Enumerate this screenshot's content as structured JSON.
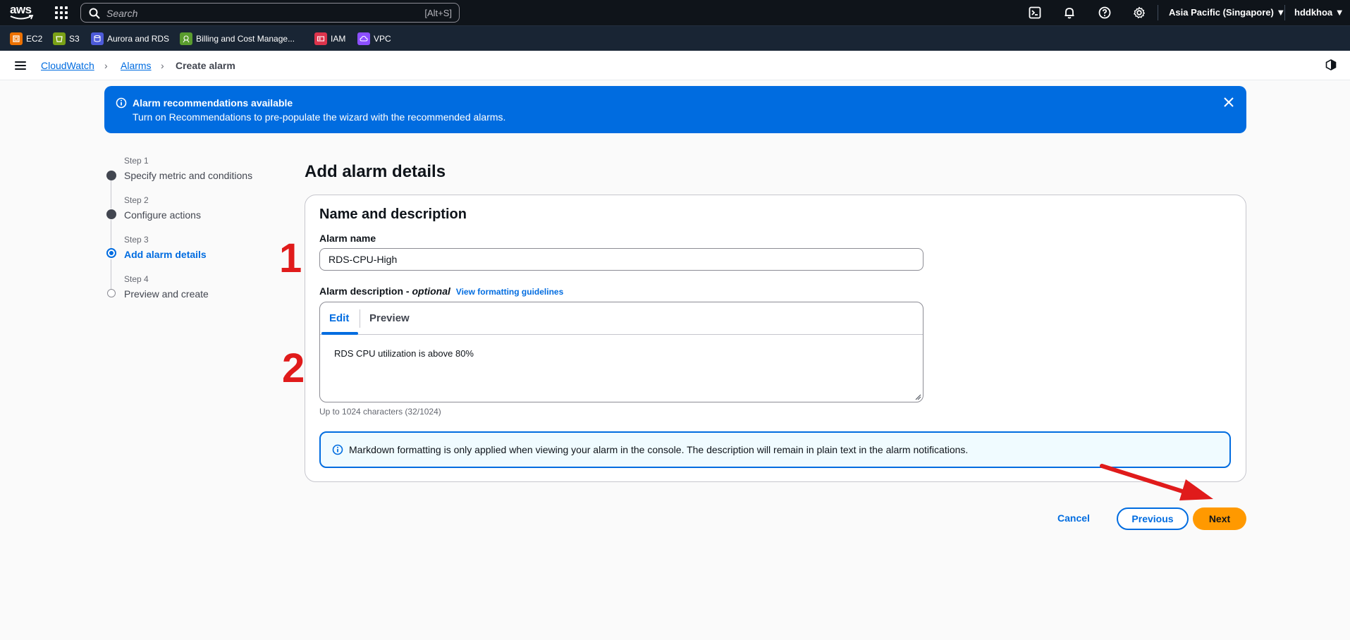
{
  "topnav": {
    "logo": "aws",
    "search_placeholder": "Search",
    "search_shortcut": "[Alt+S]",
    "region": "Asia Pacific (Singapore) ▼",
    "user": "hddkhoa ▼"
  },
  "favorites": [
    {
      "label": "EC2",
      "color": "#ed7100"
    },
    {
      "label": "S3",
      "color": "#7aa116"
    },
    {
      "label": "Aurora and RDS",
      "color": "#4d5bd9"
    },
    {
      "label": "Billing and Cost Manage...",
      "color": "#5a9c2e"
    },
    {
      "label": "IAM",
      "color": "#dd344c"
    },
    {
      "label": "VPC",
      "color": "#8c4fff"
    }
  ],
  "breadcrumb": {
    "service": "CloudWatch",
    "section": "Alarms",
    "current": "Create alarm"
  },
  "flash": {
    "title": "Alarm recommendations available",
    "message": "Turn on Recommendations to pre-populate the wizard with the recommended alarms."
  },
  "steps": [
    {
      "label": "Step 1",
      "name": "Specify metric and conditions",
      "state": "complete"
    },
    {
      "label": "Step 2",
      "name": "Configure actions",
      "state": "complete"
    },
    {
      "label": "Step 3",
      "name": "Add alarm details",
      "state": "active"
    },
    {
      "label": "Step 4",
      "name": "Preview and create",
      "state": "pending"
    }
  ],
  "main": {
    "title": "Add alarm details",
    "section_title": "Name and description",
    "alarm_name_label": "Alarm name",
    "alarm_name_value": "RDS-CPU-High",
    "description_label": "Alarm description - ",
    "description_optional": "optional",
    "formatting_link": "View formatting guidelines",
    "tab_edit": "Edit",
    "tab_preview": "Preview",
    "description_value": "RDS CPU utilization is above 80%",
    "char_hint": "Up to 1024 characters (32/1024)",
    "info_text": "Markdown formatting is only applied when viewing your alarm in the console. The description will remain in plain text in the alarm notifications."
  },
  "actions": {
    "cancel": "Cancel",
    "previous": "Previous",
    "next": "Next"
  },
  "annotations": {
    "one": "1",
    "two": "2"
  },
  "colors": {
    "primary": "#006ce0",
    "next_button": "#ff9900",
    "annotation": "#e01b1b"
  }
}
